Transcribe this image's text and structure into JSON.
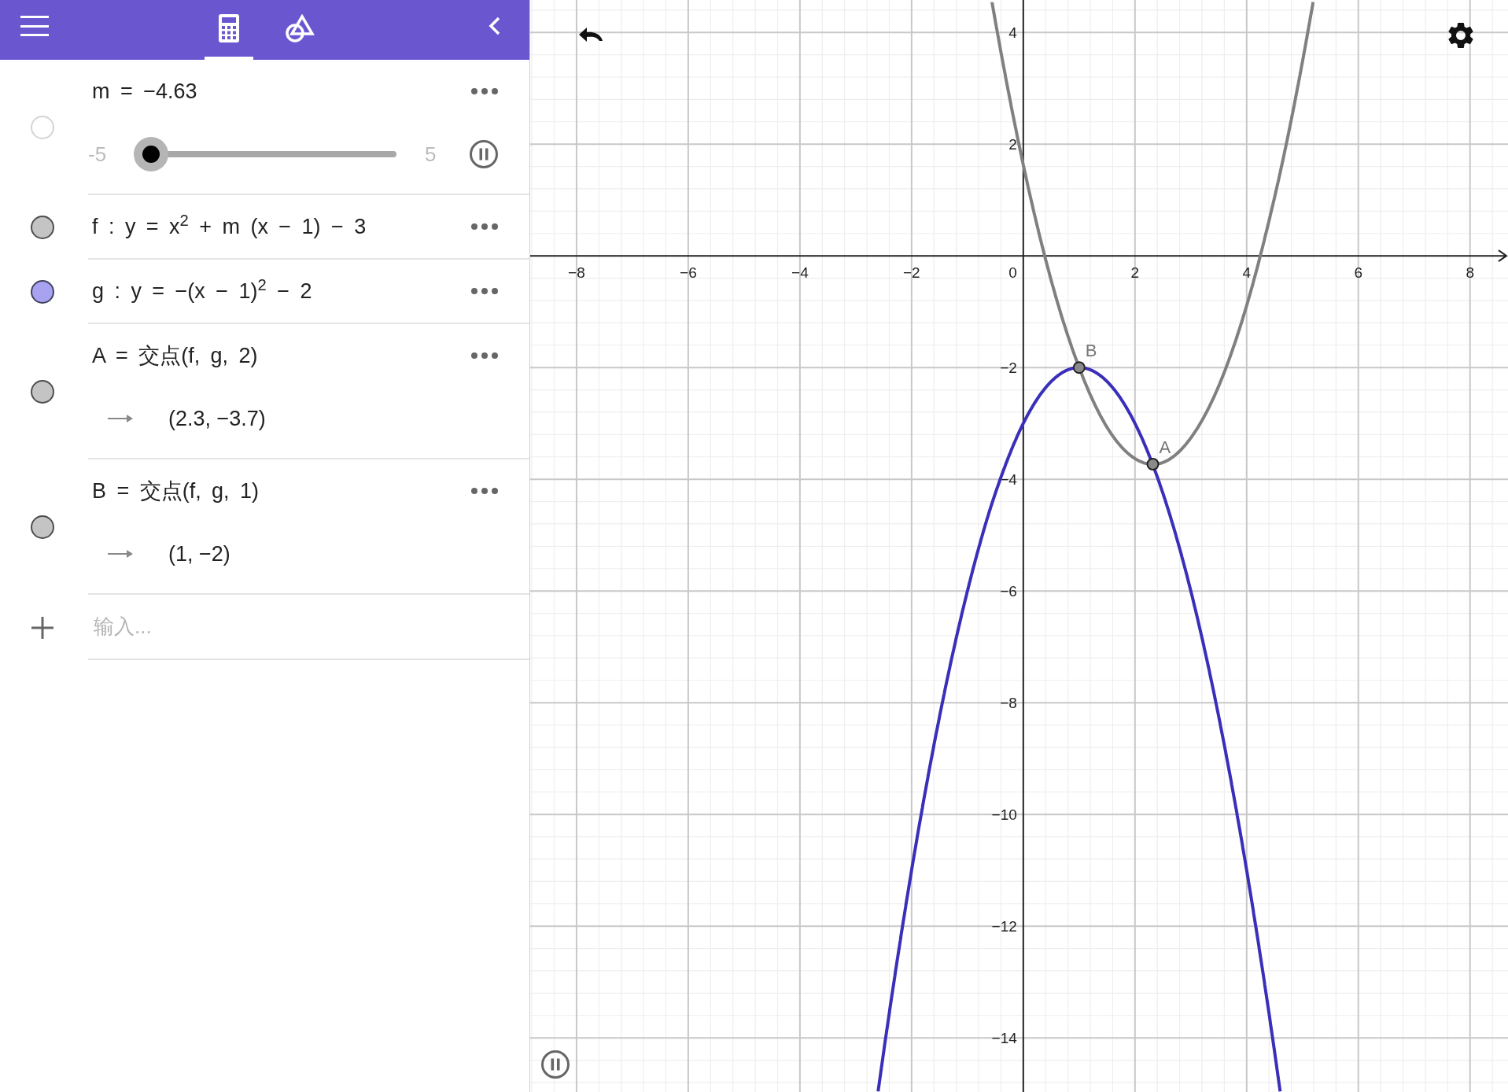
{
  "toolbar": {
    "tabs": [
      {
        "kind": "algebra",
        "selected": true
      },
      {
        "kind": "tools",
        "selected": false
      }
    ]
  },
  "algebra": {
    "items": [
      {
        "kind": "slider",
        "definition": "m = −4.63",
        "visible": false,
        "min": "-5",
        "max": "5",
        "level": 0.037,
        "animating": true
      },
      {
        "kind": "equation",
        "definition": "f :  y = x$^{2}$ + m (x − 1) − 3",
        "visible": true,
        "color": "#c4c4c4"
      },
      {
        "kind": "equation",
        "definition": "g :  y = −(x − 1)$^{2}$ − 2",
        "visible": true,
        "color": "#a7a3f0"
      },
      {
        "kind": "point",
        "definition": "A = 交点(f, g, 2)",
        "value": "(2.3, −3.7)",
        "visible": true,
        "color": "#c4c4c4"
      },
      {
        "kind": "point",
        "definition": "B = 交点(f, g, 1)",
        "value": "(1, −2)",
        "visible": true,
        "color": "#c4c4c4"
      }
    ],
    "input": {
      "placeholder": "输入..."
    }
  },
  "graph": {
    "animating": true,
    "origin_label": "0",
    "chart_data": {
      "type": "line",
      "grid": true,
      "x": [
        -2.6,
        -2.5,
        -2,
        -1.5,
        -1,
        -0.56,
        -0.5,
        0,
        0.5,
        1,
        1.5,
        2,
        2.5,
        3,
        3.5,
        4,
        4.5,
        4.6,
        5,
        5.19
      ],
      "series": [
        {
          "color": "#808080",
          "values": [
            null,
            null,
            null,
            null,
            null,
            4.54,
            4.2,
            1.63,
            -0.44,
            -2,
            -3.07,
            -3.63,
            -3.7,
            -3.26,
            -2.33,
            -0.89,
            1.05,
            1.49,
            3.48,
            4.54
          ]
        },
        {
          "color": "#3a2fb8",
          "values": [
            -14.96,
            -14.25,
            -11,
            -8.25,
            -6,
            -4.43,
            -4.25,
            -3,
            -2.25,
            -2,
            -2.25,
            -3,
            -4.25,
            -6,
            -8.25,
            -11,
            -14.25,
            -14.96,
            null,
            null
          ]
        }
      ],
      "xlim": [
        -8.83,
        8.68
      ],
      "ylim": [
        -14.97,
        4.58
      ],
      "xticks": [
        {
          "value": -8,
          "label": "−8"
        },
        {
          "value": -6,
          "label": "−6"
        },
        {
          "value": -4,
          "label": "−4"
        },
        {
          "value": -2,
          "label": "−2"
        },
        {
          "value": 2,
          "label": "2"
        },
        {
          "value": 4,
          "label": "4"
        },
        {
          "value": 6,
          "label": "6"
        },
        {
          "value": 8,
          "label": "8"
        }
      ],
      "yticks": [
        {
          "value": -14,
          "label": "−14"
        },
        {
          "value": -12,
          "label": "−12"
        },
        {
          "value": -10,
          "label": "−10"
        },
        {
          "value": -8,
          "label": "−8"
        },
        {
          "value": -6,
          "label": "−6"
        },
        {
          "value": -4,
          "label": "−4"
        },
        {
          "value": -2,
          "label": "−2"
        },
        {
          "value": 2,
          "label": "2"
        },
        {
          "value": 4,
          "label": "4"
        }
      ],
      "annotations": [
        {
          "text": "A",
          "x": 2.32,
          "y": -3.73
        },
        {
          "text": "B",
          "x": 1,
          "y": -2
        }
      ]
    }
  }
}
